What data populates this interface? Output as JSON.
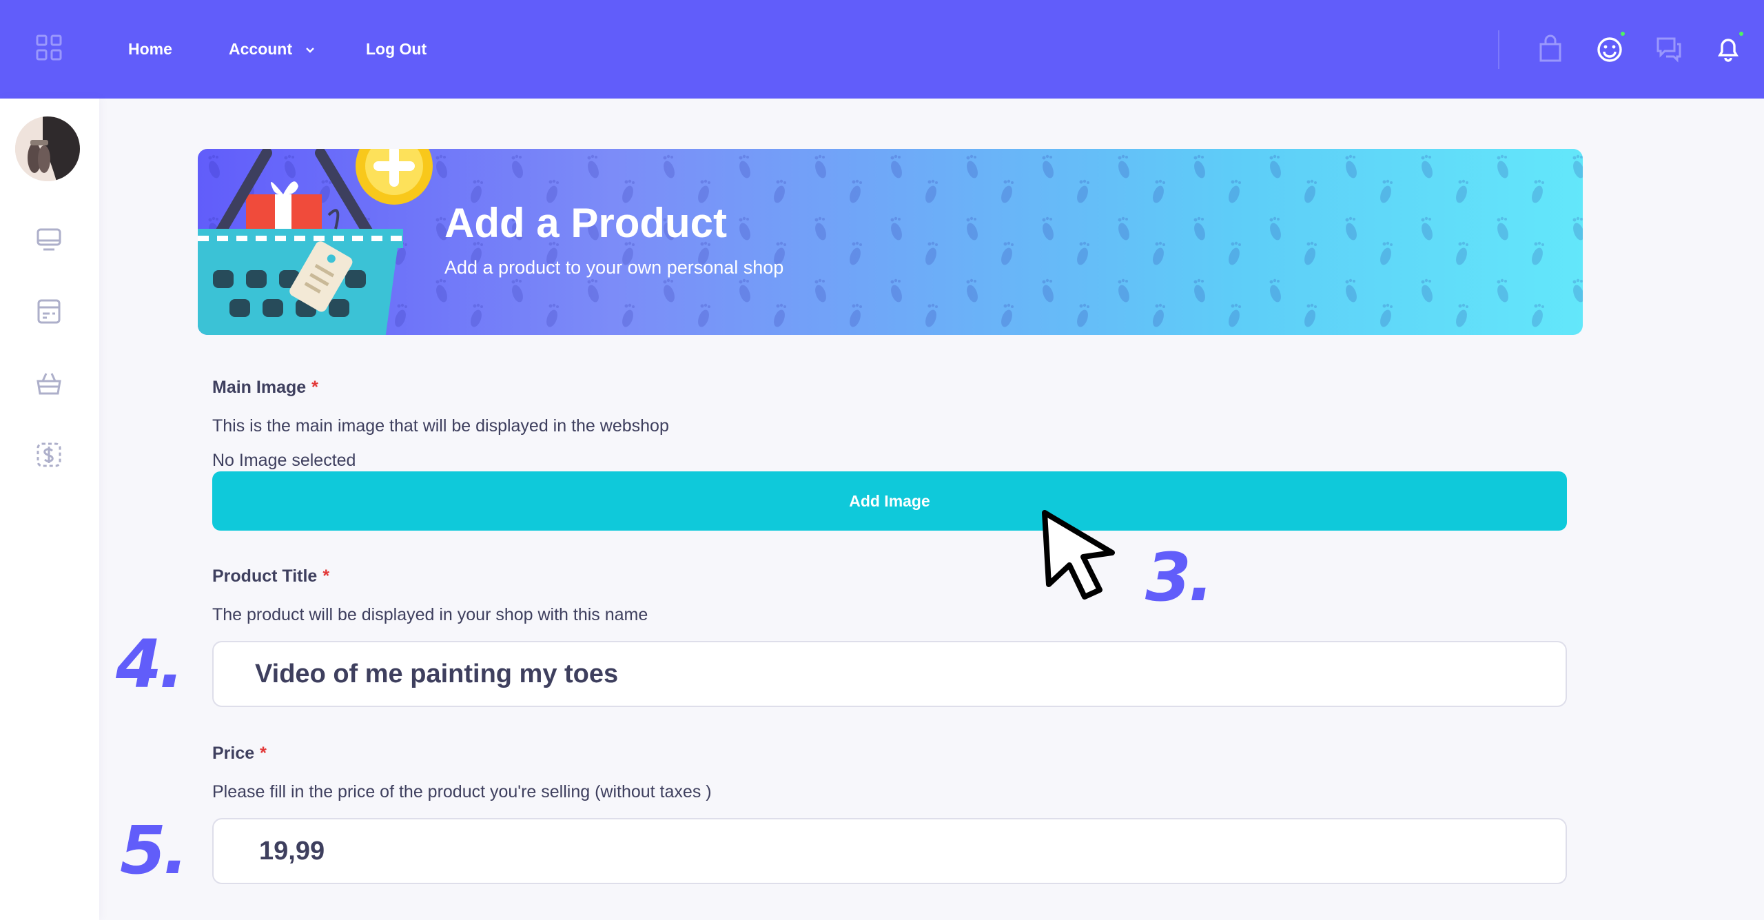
{
  "nav": {
    "home": "Home",
    "account": "Account",
    "logout": "Log Out"
  },
  "header_icons": [
    "grid-icon",
    "shopping-bag-icon",
    "smiley-icon",
    "messages-icon",
    "bell-icon"
  ],
  "sidebar": {
    "icons": [
      "monitor-icon",
      "card-icon",
      "basket-icon",
      "dollar-icon"
    ]
  },
  "banner": {
    "title": "Add a Product",
    "subtitle": "Add a product to your own personal shop"
  },
  "form": {
    "main_image": {
      "label": "Main Image",
      "required_mark": "*",
      "description": "This is the main image that will be displayed in the webshop",
      "status": "No Image selected",
      "button": "Add Image"
    },
    "product_title": {
      "label": "Product Title",
      "required_mark": "*",
      "description": "The product will be displayed in your shop with this name",
      "value": "Video of me painting my toes"
    },
    "price": {
      "label": "Price",
      "required_mark": "*",
      "description": "Please fill in the price of the product you're selling (without taxes )",
      "value": "19,99"
    }
  },
  "steps": {
    "three": "3.",
    "four": "4.",
    "five": "5."
  },
  "colors": {
    "brand": "#615dfa",
    "button": "#0fc9da",
    "required": "#e23838",
    "text": "#3e3f5e"
  }
}
